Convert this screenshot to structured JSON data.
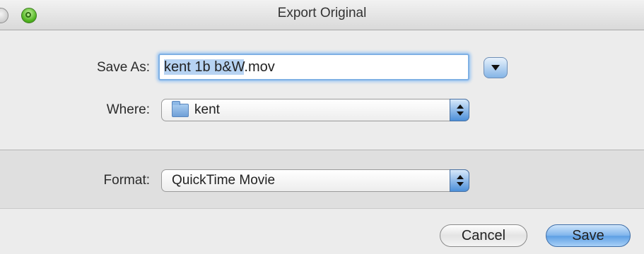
{
  "window": {
    "title": "Export Original"
  },
  "save_as": {
    "label": "Save As:",
    "value": "kent 1b b&W.mov",
    "selected_part": "kent 1b b&W",
    "unselected_part": ".mov"
  },
  "where": {
    "label": "Where:",
    "value": "kent",
    "icon": "folder-icon"
  },
  "format": {
    "label": "Format:",
    "value": "QuickTime Movie"
  },
  "buttons": {
    "cancel": "Cancel",
    "save": "Save"
  },
  "colors": {
    "accent": "#5d9fe4",
    "focus_ring": "#9cc6f2"
  }
}
